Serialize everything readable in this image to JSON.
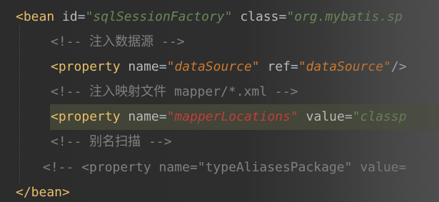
{
  "editor": {
    "lines": [
      {
        "kind": "open-tag",
        "open": "<",
        "tag": "bean",
        "a1": "id",
        "eq1": "=",
        "v1": "\"sqlSessionFactory\"",
        "a2": "class",
        "eq2": "=",
        "v2": "\"org.mybatis.sp"
      },
      {
        "kind": "comment",
        "text": "<!-- 注入数据源 -->"
      },
      {
        "kind": "property",
        "open": "<",
        "tag": "property",
        "a1": "name",
        "eq1": "=",
        "v1": "\"dataSource\"",
        "a2": "ref",
        "eq2": "=",
        "v2": "\"dataSource\"",
        "close": "/>"
      },
      {
        "kind": "comment",
        "text": "<!-- 注入映射文件 mapper/*.xml -->"
      },
      {
        "kind": "property-highlight",
        "open": "<",
        "tag": "property",
        "a1": "name",
        "eq1": "=",
        "v1": "\"mapperLocations\"",
        "a2": "value",
        "eq2": "=",
        "v2": "\"classp"
      },
      {
        "kind": "comment",
        "text": "<!-- 别名扫描 -->"
      },
      {
        "kind": "comment",
        "text": "<!-- <property name=\"typeAliasesPackage\" value="
      },
      {
        "kind": "close-tag",
        "text": "</bean>"
      }
    ]
  }
}
